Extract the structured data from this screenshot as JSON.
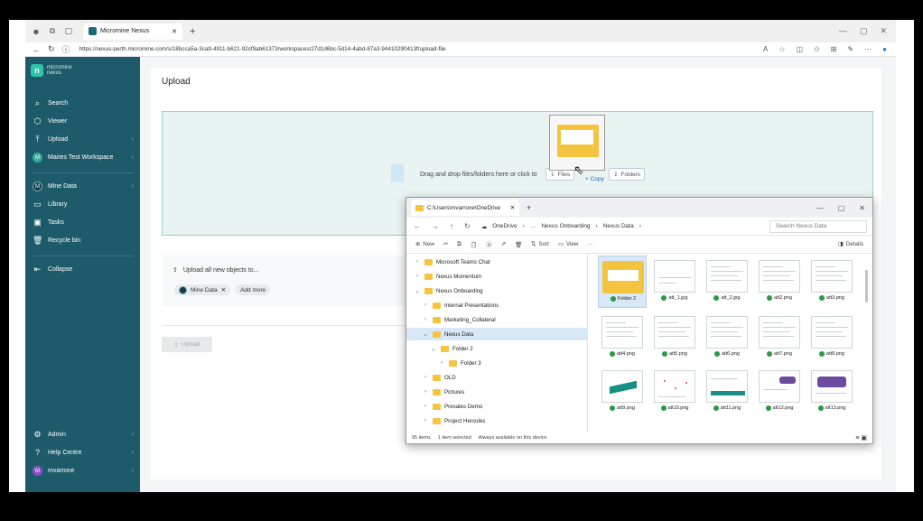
{
  "browser": {
    "tab_title": "Micromine Nexus",
    "url": "https://nexus-perth.micromine.com/s/18bcca5a-3ca9-4911-b621-92cf9ab61373/workspaces/27d1d6bc-5d14-4abd-87a3-94410290413f/upload-file"
  },
  "app": {
    "logo_line1": "micromine",
    "logo_line2": "nexus",
    "logo_mark": "n"
  },
  "sidebar": {
    "items": [
      {
        "label": "Search",
        "icon": "search-icon"
      },
      {
        "label": "Viewer",
        "icon": "cube-icon"
      },
      {
        "label": "Upload",
        "icon": "upload-icon"
      },
      {
        "label": "Maries Test Workspace",
        "icon": "workspace-avatar",
        "badge": "M"
      },
      {
        "label": "Mine Data",
        "icon": "workspace-badge",
        "badge": "M"
      },
      {
        "label": "Library",
        "icon": "library-icon"
      },
      {
        "label": "Tasks",
        "icon": "tasks-icon"
      },
      {
        "label": "Recycle bin",
        "icon": "trash-icon"
      },
      {
        "label": "Collapse",
        "icon": "collapse-icon"
      }
    ],
    "bottom": [
      {
        "label": "Admin",
        "icon": "gear-icon"
      },
      {
        "label": "Help Centre",
        "icon": "help-icon"
      },
      {
        "label": "mvarrone",
        "icon": "user-avatar",
        "badge": "M"
      }
    ]
  },
  "main": {
    "title": "Upload",
    "dropzone_text": "Drag and drop files/folders here or click to",
    "files_btn": "Files",
    "folders_btn": "Folders",
    "copy_tag": "+ Copy",
    "upload_all_text": "Upload all new objects to...",
    "chip_mine_data": "Mine Data",
    "chip_add_more": "Add more",
    "upload_btn": "Upload"
  },
  "explorer": {
    "tab_title": "C:\\Users\\mvarrone\\OneDrive",
    "crumbs": [
      "OneDrive",
      "…",
      "Nexus Onboarding",
      "Nexus Data"
    ],
    "search_placeholder": "Search Nexus Data",
    "tools": {
      "new": "New",
      "sort": "Sort",
      "view": "View",
      "more": "···",
      "details": "Details"
    },
    "tree": [
      {
        "label": "Microsoft Teams Chat",
        "level": 0,
        "open": false
      },
      {
        "label": "Nexus Momentum",
        "level": 0,
        "open": false
      },
      {
        "label": "Nexus Onboarding",
        "level": 0,
        "open": true
      },
      {
        "label": "Internal Presentations",
        "level": 1,
        "open": false
      },
      {
        "label": "Marketing_Collateral",
        "level": 1,
        "open": false
      },
      {
        "label": "Nexus Data",
        "level": 1,
        "open": true,
        "selected": true
      },
      {
        "label": "Folder 2",
        "level": 2,
        "open": true
      },
      {
        "label": "Folder 3",
        "level": 3,
        "open": false
      },
      {
        "label": "OLD",
        "level": 1,
        "open": false
      },
      {
        "label": "Pictures",
        "level": 1,
        "open": false
      },
      {
        "label": "Presales Demo",
        "level": 1,
        "open": false
      },
      {
        "label": "Project Hercules",
        "level": 1,
        "open": false
      }
    ],
    "files": [
      {
        "name": "Folder 2",
        "kind": "folder",
        "selected": true
      },
      {
        "name": "att_1.jpg",
        "kind": "dots"
      },
      {
        "name": "att_2.jpg",
        "kind": "doc"
      },
      {
        "name": "att2.png",
        "kind": "doc"
      },
      {
        "name": "att3.png",
        "kind": "doc"
      },
      {
        "name": "att4.png",
        "kind": "doc"
      },
      {
        "name": "att5.png",
        "kind": "doc"
      },
      {
        "name": "att6.png",
        "kind": "doc"
      },
      {
        "name": "att7.png",
        "kind": "doc"
      },
      {
        "name": "att8.png",
        "kind": "doc"
      },
      {
        "name": "att9.png",
        "kind": "teal"
      },
      {
        "name": "att10.png",
        "kind": "reddots"
      },
      {
        "name": "att11.png",
        "kind": "tealbar"
      },
      {
        "name": "att12.png",
        "kind": "purple"
      },
      {
        "name": "att13.png",
        "kind": "purplebox"
      }
    ],
    "status_count": "95 items",
    "status_selected": "1 item selected",
    "status_avail": "Always available on this device"
  }
}
